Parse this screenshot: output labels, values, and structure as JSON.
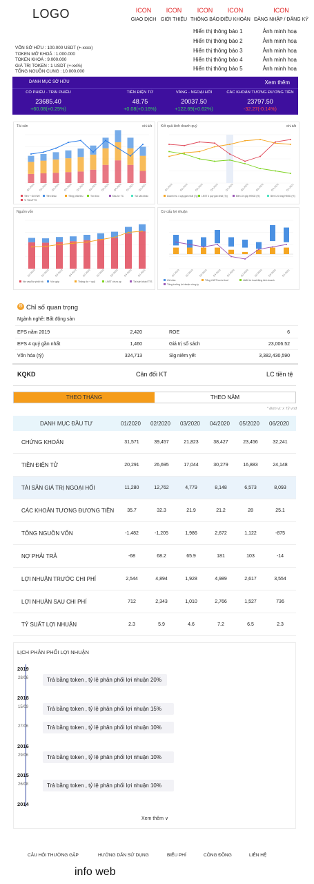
{
  "header": {
    "logo": "LOGO",
    "nav": [
      {
        "icon": "ICON",
        "label": "GIAO DỊCH"
      },
      {
        "icon": "ICON",
        "label": "GIỚI THIỆU"
      },
      {
        "icon": "ICON",
        "label": "THÔNG BÁO"
      },
      {
        "icon": "ICON",
        "label": "ĐIỀU KHOẢN"
      },
      {
        "icon": "ICON",
        "label": "ĐĂNG NHẬP / ĐĂNG KÝ"
      }
    ],
    "notices": [
      {
        "text": "Hiển thị thông báo 1",
        "image": "Ảnh minh hoạ"
      },
      {
        "text": "Hiển thị thông báo 2",
        "image": "Ảnh minh hoạ"
      },
      {
        "text": "Hiển thị thông báo 3",
        "image": "Ảnh minh hoạ"
      },
      {
        "text": "Hiển thị thông báo 4",
        "image": "Ảnh minh hoạ"
      },
      {
        "text": "Hiển thị thông báo 5",
        "image": "Ảnh minh hoạ"
      }
    ]
  },
  "token_info": [
    "VỐN SỞ HỮU : 100.000 USDT (+-xxxx)",
    "TOKEN MỞ KHOÁ : 1.000.000",
    "TOKEN KHOÁ : 9.000.000",
    "GIÁ TRỊ TOKEN : 1 USDT (+-xx%)",
    "TỔNG NGUỒN CUNG : 10.000.000"
  ],
  "portfolio": {
    "title": "DANH MỤC SỞ HỮU",
    "more": "Xem thêm",
    "cells": [
      {
        "name": "CỔ PHIẾU - TRÁI PHIẾU",
        "value": "23685.40",
        "change": "+60.08(+0.25%)",
        "dir": "up"
      },
      {
        "name": "TIỀN ĐIỆN TỬ",
        "value": "48.75",
        "change": "+0.08(+0.16%)",
        "dir": "up"
      },
      {
        "name": "VÀNG - NGOẠI HỐI",
        "value": "20037.50",
        "change": "+122.69(+0.62%)",
        "dir": "up"
      },
      {
        "name": "CÁC KHOẢN TƯƠNG ĐƯƠNG TIỀN",
        "value": "23797.50",
        "change": "-32.27(-0.14%)",
        "dir": "down"
      }
    ]
  },
  "charts": {
    "btn": "Chi tiết",
    "assets": {
      "title": "Tài sản",
      "legend": [
        "Tiền + Gửi NH",
        "Tiền khác",
        "Tổng phải thu",
        "Tồn kho",
        "Đầu tư TC",
        "Tài sản khác",
        "% Tiền/TTS"
      ]
    },
    "business": {
      "title": "Kết quả kinh doanh quý",
      "legend": [
        "Doanh thu 4 quý gần nhất (Tỷ)",
        "LNST 4 quý gần nhất (Tỷ)",
        "Biên LN gộp HĐKD (%)",
        "Biên LN ròng HĐKD (%)"
      ]
    },
    "capital": {
      "title": "Nguồn vốn",
      "legend": [
        "Nợ vay/Nợ phải trả",
        "Vốn góp",
        "Thặng dư + quỹ",
        "LNST chưa pp",
        "Tài sản khác/TTS"
      ]
    },
    "profit": {
      "title": "Cơ cấu lợi nhuận",
      "legend": [
        "LN khác",
        "Tổng LNST trước thuế",
        "Lãi/lỗ từ hoạt động kinh doanh",
        "Tăng trưởng lợi nhuận công ty"
      ]
    }
  },
  "chart_data": [
    {
      "type": "bar",
      "title": "Tài sản",
      "categories": [
        "Q1-2019",
        "Q2-2019",
        "Q3-2019",
        "Q4-2019",
        "Q1-2020",
        "Q2-2020",
        "Q3-2020",
        "Q4-2020",
        "Q1-2021",
        "Q2-2021"
      ],
      "series": [
        {
          "name": "Tiền + Gửi NH",
          "values": [
            30,
            32,
            34,
            36,
            38,
            44,
            60,
            75,
            60,
            40
          ]
        },
        {
          "name": "Tổng phải thu",
          "values": [
            40,
            42,
            44,
            46,
            48,
            50,
            55,
            60,
            55,
            50
          ]
        },
        {
          "name": "Đầu tư TC",
          "values": [
            20,
            22,
            24,
            26,
            28,
            30,
            35,
            40,
            35,
            30
          ]
        },
        {
          "name": "% Tiền/TTS",
          "values": [
            15,
            16,
            18,
            21,
            22,
            16,
            22,
            18,
            14,
            20
          ]
        }
      ]
    },
    {
      "type": "line",
      "title": "Kết quả kinh doanh quý",
      "categories": [
        "Q1-2019",
        "Q2-2019",
        "Q3-2019",
        "Q4-2019",
        "Q1-2020",
        "Q2-2020",
        "Q3-2020",
        "Q4-2020",
        "Q1-2021"
      ],
      "series": [
        {
          "name": "Doanh thu 4 quý gần nhất (Tỷ)",
          "values": [
            110,
            125,
            130,
            150,
            160,
            175,
            180,
            165,
            160
          ]
        },
        {
          "name": "LNST 4 quý gần nhất (Tỷ)",
          "values": [
            160,
            155,
            170,
            165,
            120,
            90,
            110,
            170,
            180
          ]
        },
        {
          "name": "Biên LN gộp HĐKD (%)",
          "values": [
            130,
            120,
            100,
            90,
            95,
            80,
            60,
            50,
            40
          ]
        }
      ]
    },
    {
      "type": "bar",
      "title": "Nguồn vốn",
      "categories": [
        "Q1-2019",
        "Q2-2019",
        "Q3-2019",
        "Q4-2019",
        "Q1-2020",
        "Q2-2020",
        "Q3-2020",
        "Q4-2020",
        "Q1-2021"
      ],
      "series": [
        {
          "name": "Nợ vay/Nợ phải trả",
          "values": [
            120,
            118,
            122,
            125,
            130,
            135,
            140,
            160,
            170
          ]
        },
        {
          "name": "Vốn góp",
          "values": [
            20,
            20,
            22,
            22,
            24,
            26,
            28,
            30,
            32
          ]
        },
        {
          "name": "Tài sản khác/TTS",
          "values": [
            90,
            92,
            100,
            105,
            110,
            120,
            130,
            150,
            155
          ]
        }
      ]
    },
    {
      "type": "bar",
      "title": "Cơ cấu lợi nhuận",
      "categories": [
        "Q1-2019",
        "Q2-2019",
        "Q3-2019",
        "Q4-2019",
        "Q1-2020",
        "Q2-2020",
        "Q3-2020",
        "Q4-2020",
        "Q1-2021"
      ],
      "series": [
        {
          "name": "LN khác",
          "values": [
            80,
            60,
            70,
            100,
            70,
            60,
            50,
            120,
            110
          ]
        },
        {
          "name": "Tổng LNST trước thuế",
          "values": [
            60,
            60,
            60,
            60,
            40,
            20,
            40,
            60,
            60
          ]
        },
        {
          "name": "Tăng trưởng lợi nhuận công ty",
          "values": [
            50,
            40,
            30,
            40,
            -10,
            -20,
            20,
            30,
            40
          ]
        }
      ]
    }
  ],
  "key_indicators": {
    "title": "Chỉ số quan trọng",
    "sector": "Ngành nghề: Bất động sản",
    "left": [
      {
        "label": "EPS năm 2019",
        "value": "2,420"
      },
      {
        "label": "EPS 4 quý gần nhất",
        "value": "1,460"
      },
      {
        "label": "Vốn hóa (tỷ)",
        "value": "324,713"
      }
    ],
    "right": [
      {
        "label": "ROE",
        "value": "6"
      },
      {
        "label": "Giá trị sổ sách",
        "value": "23,006.52"
      },
      {
        "label": "Slg niêm yết",
        "value": "3,382,430,590"
      }
    ]
  },
  "tabs": {
    "a": "KQKD",
    "b": "Cân đối KT",
    "c": "LC tiền tệ"
  },
  "period": {
    "month": "THEO THÁNG",
    "year": "THEO NĂM"
  },
  "table": {
    "unit": "* Đơn vị: x Tỷ vnđ",
    "header": "DANH MỤC ĐẦU TƯ",
    "months": [
      "01/2020",
      "02/2020",
      "03/2020",
      "04/2020",
      "05/2020",
      "06/2020"
    ],
    "rows": [
      {
        "label": "CHỨNG KHOÁN",
        "values": [
          "31,571",
          "39,457",
          "21,823",
          "38,427",
          "23,456",
          "32,241"
        ]
      },
      {
        "label": "TIỀN ĐIỆN TỬ",
        "values": [
          "20,291",
          "26,695",
          "17,044",
          "30,279",
          "16,883",
          "24,148"
        ]
      },
      {
        "label": "TÀI SẢN GIÁ TRỊ NGOẠI HỐI",
        "values": [
          "11,280",
          "12,762",
          "4,779",
          "8,148",
          "6,573",
          "8,093"
        ]
      },
      {
        "label": "CÁC KHOẢN TƯƠNG ĐƯƠNG TIỀN",
        "values": [
          "35.7",
          "32.3",
          "21.9",
          "21.2",
          "28",
          "25.1"
        ]
      },
      {
        "label": "TỔNG NGUỒN VỐN",
        "values": [
          "-1,482",
          "-1,205",
          "1,986",
          "2,672",
          "1,122",
          "-875"
        ]
      },
      {
        "label": "NỢ PHẢI TRẢ",
        "values": [
          "-68",
          "68.2",
          "65.9",
          "181",
          "103",
          "-14"
        ]
      },
      {
        "label": "LỢI NHUẬN TRƯỚC CHI PHÍ",
        "values": [
          "2,544",
          "4,894",
          "1,928",
          "4,989",
          "2,617",
          "3,554"
        ]
      },
      {
        "label": "LỢI NHUẬN SAU CHI PHÍ",
        "values": [
          "712",
          "2,343",
          "1,010",
          "2,766",
          "1,527",
          "736"
        ]
      },
      {
        "label": "TỶ SUẤT LỢI NHUẬN",
        "values": [
          "2.3",
          "5.9",
          "4.6",
          "7.2",
          "6.5",
          "2.3"
        ]
      }
    ]
  },
  "history": {
    "title": "LỊCH PHÂN PHỐI LỢI NHUẬN",
    "years": [
      "2019",
      "2018",
      "2016",
      "2015",
      "2014"
    ],
    "items": [
      {
        "date": "28/06",
        "text": "Trả bằng token , tỷ lệ phân phối lợi nhuận 20%"
      },
      {
        "date": "15/09",
        "text": "Trả bằng token , tỷ lệ phân phối lợi nhuận 15%"
      },
      {
        "date": "27/06",
        "text": "Trả bằng token , tỷ lệ phân phối lợi nhuận 10%"
      },
      {
        "date": "29/06",
        "text": "Trả bằng token , tỷ lệ phân phối lợi nhuận 10%"
      },
      {
        "date": "26/08",
        "text": "Trả bằng token , tỷ lệ phân phối lợi nhuận 10%"
      }
    ],
    "more": "Xem thêm ∨"
  },
  "footer": {
    "links": [
      "CÂU HỎI THƯỜNG GẶP",
      "HƯỚNG DẪN SỬ DỤNG",
      "BIỂU PHÍ",
      "CÔNG ĐỒNG",
      "LIÊN HỆ"
    ],
    "info": "info web"
  },
  "colors": {
    "band": "#3e0f9e",
    "accent": "#f59c1a",
    "up": "#36d063",
    "down": "#ff4a4a",
    "table_head": "#e8f5fb"
  }
}
